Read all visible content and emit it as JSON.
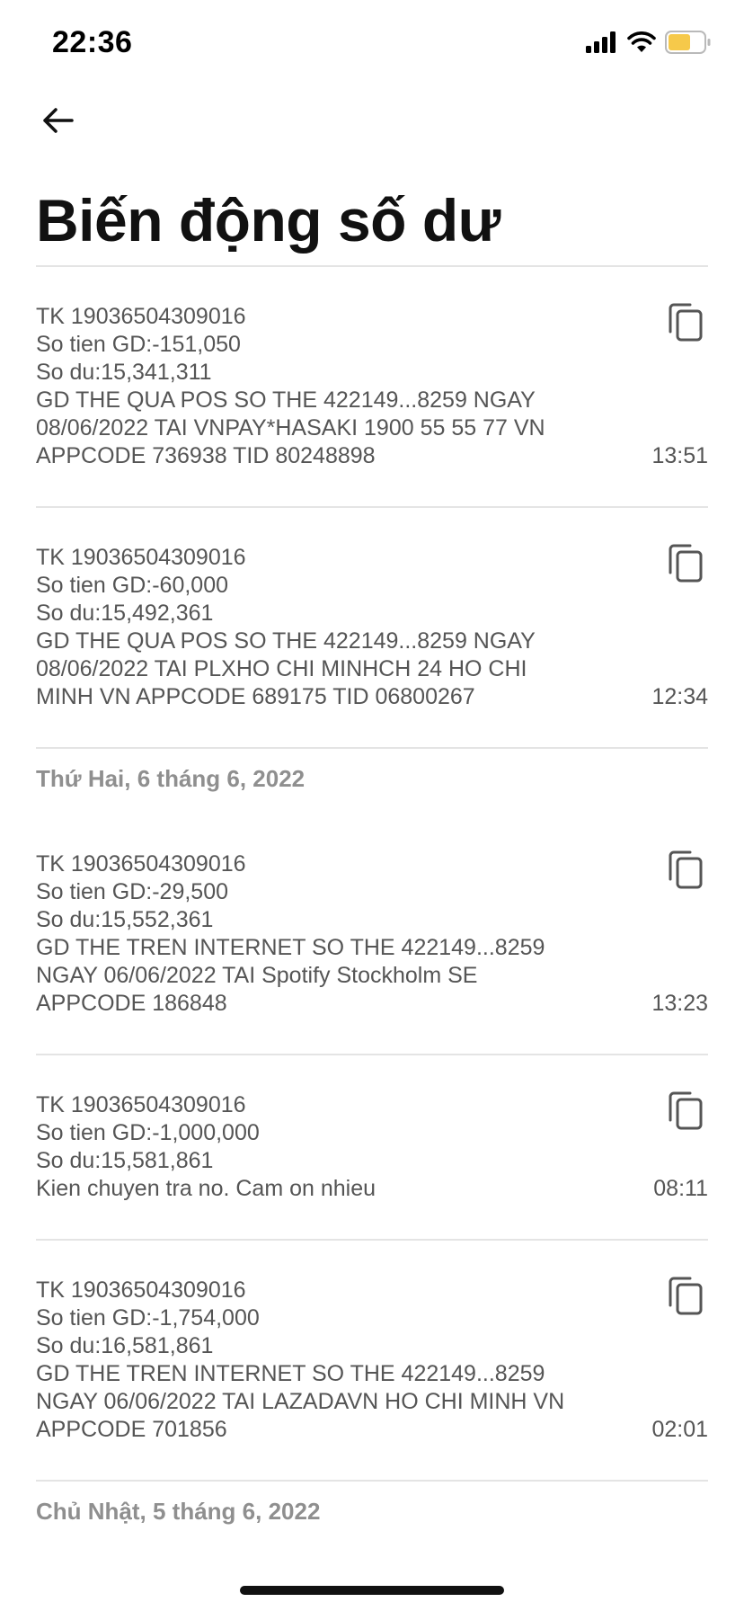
{
  "status_bar": {
    "time": "22:36",
    "icons": [
      "cellular-signal-icon",
      "wifi-icon",
      "battery-icon"
    ],
    "battery_color": "#f6c94a"
  },
  "header": {
    "back_icon": "arrow-left-icon",
    "title": "Biến động số dư"
  },
  "feed": [
    {
      "kind": "txn",
      "lines": [
        "TK 19036504309016",
        "So tien GD:-151,050",
        "So du:15,341,311",
        "GD THE QUA POS SO THE 422149...8259 NGAY",
        "08/06/2022 TAI VNPAY*HASAKI 1900 55 55 77 VN",
        "APPCODE 736938 TID 80248898"
      ],
      "time": "13:51"
    },
    {
      "kind": "txn",
      "lines": [
        "TK 19036504309016",
        "So tien GD:-60,000",
        "So du:15,492,361",
        "GD THE QUA POS SO THE 422149...8259 NGAY",
        "08/06/2022 TAI PLXHO CHI MINHCH 24 HO CHI",
        "MINH VN APPCODE 689175 TID 06800267"
      ],
      "time": "12:34"
    },
    {
      "kind": "date",
      "label": "Thứ Hai, 6 tháng 6, 2022"
    },
    {
      "kind": "txn",
      "lines": [
        "TK 19036504309016",
        "So tien GD:-29,500",
        "So du:15,552,361",
        "GD THE TREN INTERNET SO THE 422149...8259",
        "NGAY 06/06/2022 TAI Spotify Stockholm SE",
        "APPCODE 186848"
      ],
      "time": "13:23"
    },
    {
      "kind": "txn",
      "lines": [
        "TK 19036504309016",
        "So tien GD:-1,000,000",
        "So du:15,581,861",
        "Kien chuyen tra no. Cam on nhieu"
      ],
      "time": "08:11"
    },
    {
      "kind": "txn",
      "lines": [
        "TK 19036504309016",
        "So tien GD:-1,754,000",
        "So du:16,581,861",
        "GD THE TREN INTERNET SO THE 422149...8259",
        "NGAY 06/06/2022 TAI LAZADAVN HO CHI MINH VN",
        "APPCODE 701856"
      ],
      "time": "02:01"
    },
    {
      "kind": "date",
      "label": "Chủ Nhật, 5 tháng 6, 2022"
    }
  ]
}
